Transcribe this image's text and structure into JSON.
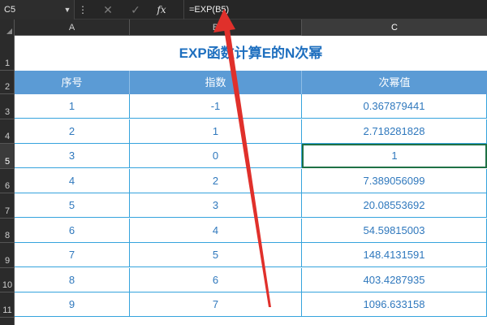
{
  "formula_bar": {
    "name_box": "C5",
    "name_box_dropdown_icon": "chevron-down-icon",
    "more_icon": "vertical-dots-icon",
    "cancel_icon": "close-icon",
    "enter_icon": "check-icon",
    "fx_label": "fx",
    "formula": "=EXP(B5)"
  },
  "columns": [
    "A",
    "B",
    "C"
  ],
  "selected_column": "C",
  "rows": [
    "1",
    "2",
    "3",
    "4",
    "5",
    "6",
    "7",
    "8",
    "9",
    "10",
    "11"
  ],
  "selected_row": "5",
  "sheet": {
    "title": "EXP函数计算E的N次幂",
    "headers": [
      "序号",
      "指数",
      "次幂值"
    ],
    "data": [
      [
        "1",
        "-1",
        "0.367879441"
      ],
      [
        "2",
        "1",
        "2.718281828"
      ],
      [
        "3",
        "0",
        "1"
      ],
      [
        "4",
        "2",
        "7.389056099"
      ],
      [
        "5",
        "3",
        "20.08553692"
      ],
      [
        "6",
        "4",
        "54.59815003"
      ],
      [
        "7",
        "5",
        "148.4131591"
      ],
      [
        "8",
        "6",
        "403.4287935"
      ],
      [
        "9",
        "7",
        "1096.633158"
      ]
    ]
  },
  "colors": {
    "title": "#1e6fbf",
    "header_fill": "#5b9bd5",
    "cell_text": "#2f78bd",
    "grid": "#35a3dd",
    "active_cell_border": "#1e7145",
    "annotation_arrow": "#e0302b"
  }
}
